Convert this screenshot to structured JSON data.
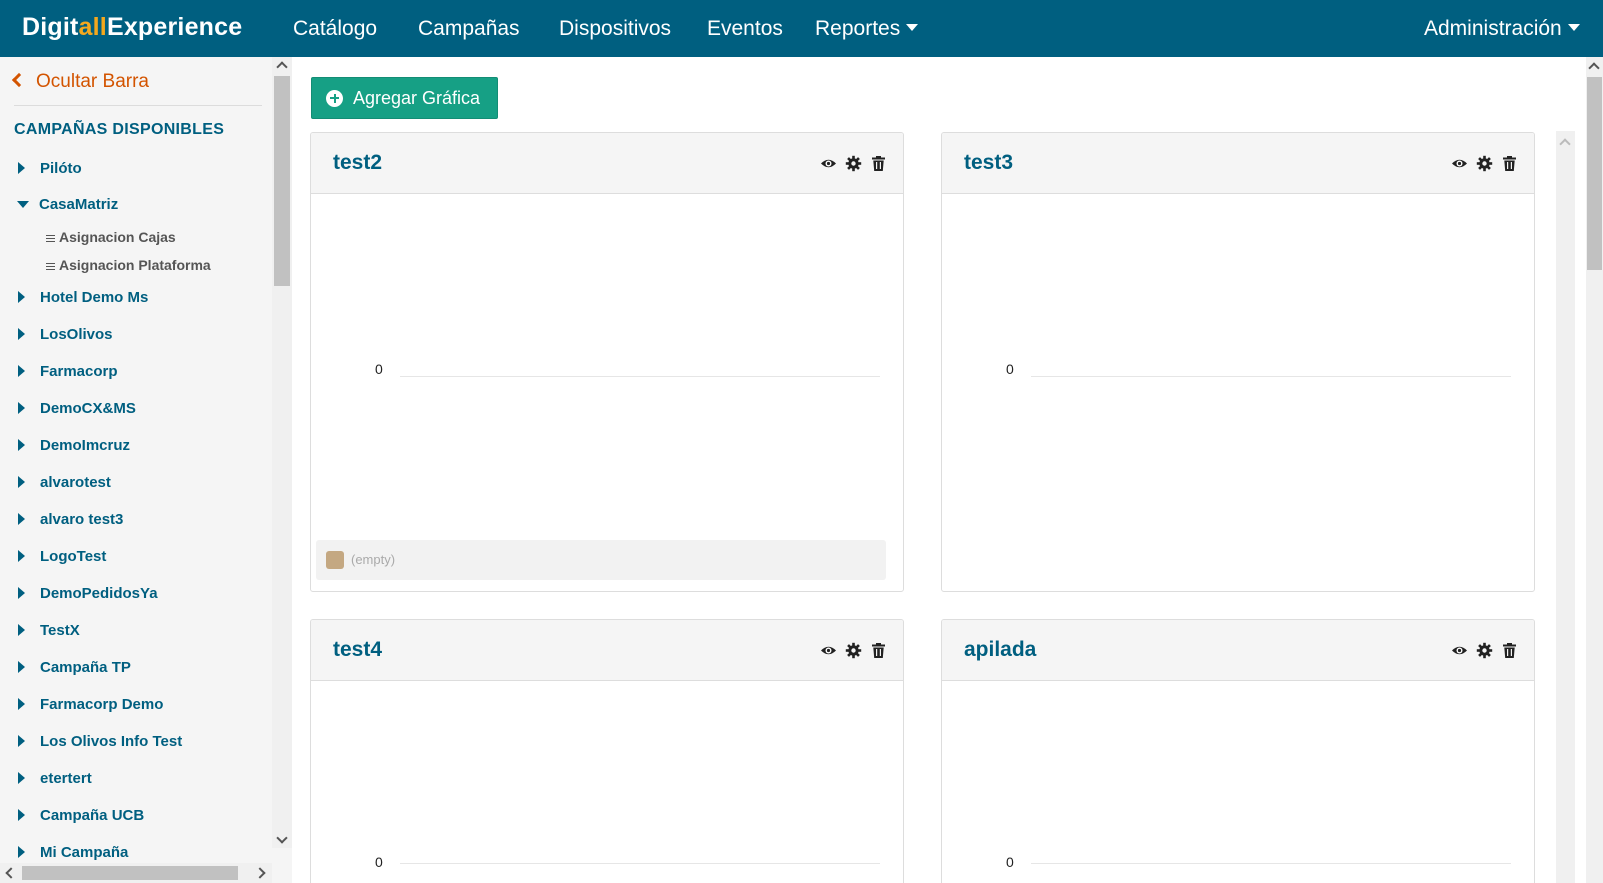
{
  "brand": {
    "part1": "Digit",
    "part2": "all",
    "part3": "Experience"
  },
  "nav": {
    "catalogo": "Catálogo",
    "campanas": "Campañas",
    "dispositivos": "Dispositivos",
    "eventos": "Eventos",
    "reportes": "Reportes",
    "administracion": "Administración"
  },
  "sidebar": {
    "hide_label": "Ocultar Barra",
    "heading": "CAMPAÑAS DISPONIBLES",
    "campaigns": [
      "Pilóto",
      "CasaMatriz",
      "Hotel Demo Ms",
      "LosOlivos",
      "Farmacorp",
      "DemoCX&MS",
      "DemoImcruz",
      "alvarotest",
      "alvaro test3",
      "LogoTest",
      "DemoPedidosYa",
      "TestX",
      "Campaña TP",
      "Farmacorp Demo",
      "Los Olivos Info Test",
      "etertert",
      "Campaña UCB",
      "Mi Campaña"
    ],
    "casamatriz_children": [
      "Asignacion Cajas",
      "Asignacion Plataforma"
    ]
  },
  "main": {
    "add_button": "Agregar Gráfica",
    "cards": [
      {
        "title": "test2",
        "axis_value": "0",
        "legend": "(empty)"
      },
      {
        "title": "test3",
        "axis_value": "0"
      },
      {
        "title": "test4",
        "axis_value": "0"
      },
      {
        "title": "apilada",
        "axis_value": "0"
      }
    ]
  },
  "colors": {
    "navbar": "#005f80",
    "brand_accent": "#f4a81d",
    "hide_bar": "#d35400",
    "button": "#16a085",
    "legend_swatch": "#c4a882"
  },
  "icons": [
    "eye-icon",
    "gear-icon",
    "trash-icon",
    "plus-circle-icon",
    "chevron-left-icon",
    "caret-down-icon"
  ]
}
